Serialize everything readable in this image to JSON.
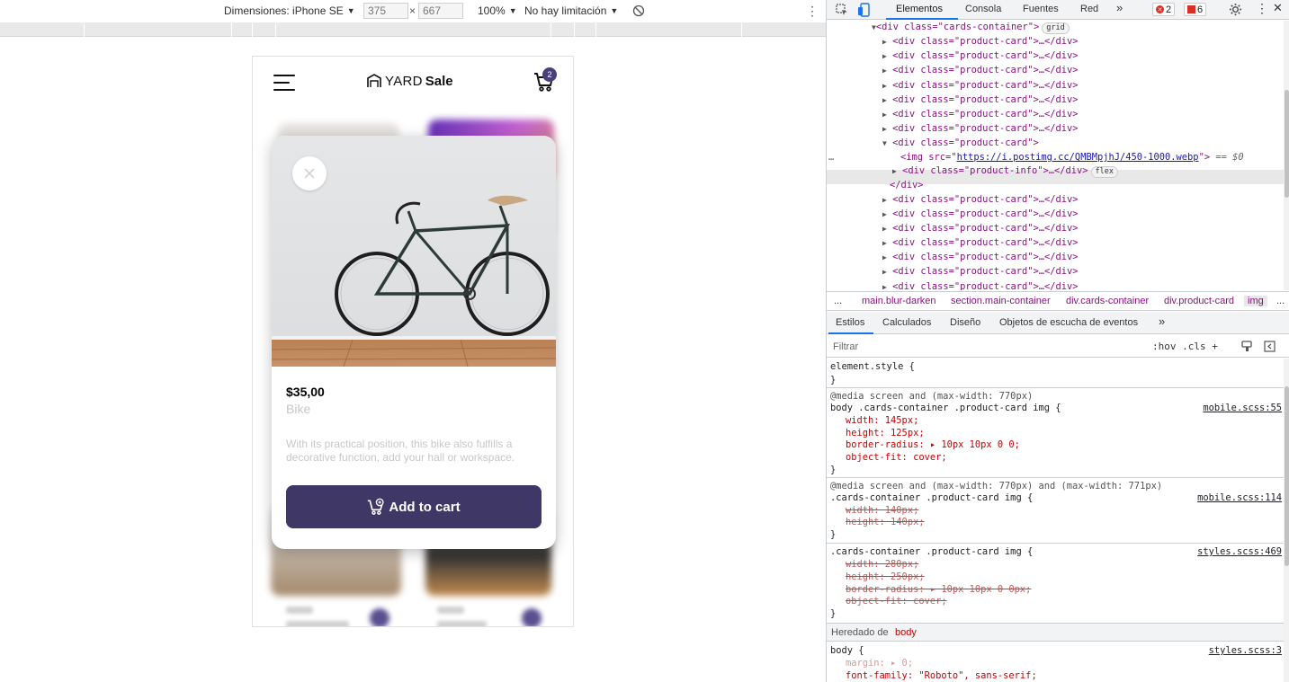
{
  "device_toolbar": {
    "dimensions_label": "Dimensiones: iPhone SE",
    "width": "375",
    "height": "667",
    "times": "×",
    "zoom": "100%",
    "throttle": "No hay limitación"
  },
  "app": {
    "logo_yard": "YARD",
    "logo_sale": "Sale",
    "cart_count": "2"
  },
  "modal": {
    "price": "$35,00",
    "name": "Bike",
    "description": "With its practical position, this bike also fulfills a decorative function, add your hall or workspace.",
    "add_label": "Add to cart"
  },
  "devtools": {
    "tabs": [
      "Elementos",
      "Consola",
      "Fuentes",
      "Red"
    ],
    "errors": "2",
    "warnings": "6",
    "more": "»",
    "dom": {
      "container_open": "<div class=\"cards-container\">",
      "grid": "grid",
      "card_collapsed": "<div class=\"product-card\">…</div>",
      "card_open": "<div class=\"product-card\">",
      "img_tag_prefix": "<img src=\"",
      "img_url": "https://i.postimg.cc/QMBMpjhJ/450-1000.webp",
      "img_tag_suffix": "\">",
      "selected_marker": "== $0",
      "info_line": "<div class=\"product-info\">…</div>",
      "flex": "flex",
      "close_div": "</div>"
    },
    "breadcrumbs": [
      "...",
      "main.blur-darken",
      "section.main-container",
      "div.cards-container",
      "div.product-card",
      "img",
      "..."
    ],
    "style_tabs": [
      "Estilos",
      "Calculados",
      "Diseño",
      "Objetos de escucha de eventos",
      "»"
    ],
    "filter_placeholder": "Filtrar",
    "filter_tools": ":hov  .cls  +",
    "rules": {
      "element_style": "element.style {",
      "close_brace": "}",
      "media1": "@media screen and (max-width: 770px)",
      "selector1": "body .cards-container .product-card img {",
      "source1": "mobile.scss:55",
      "r1_width": "width: 145px;",
      "r1_height": "height: 125px;",
      "r1_radius": "border-radius: ▸ 10px 10px 0 0;",
      "r1_fit": "object-fit: cover;",
      "media2": "@media screen and (max-width: 770px) and (max-width: 771px)",
      "selector2": ".cards-container .product-card img {",
      "source2": "mobile.scss:114",
      "r2_width": "width: 140px;",
      "r2_height": "height: 140px;",
      "selector3": ".cards-container .product-card img {",
      "source3": "styles.scss:469",
      "r3_width": "width: 280px;",
      "r3_height": "height: 250px;",
      "r3_radius": "border-radius: ▸ 10px 10px 0 0px;",
      "r3_fit": "object-fit: cover;",
      "inherited_prefix": "Heredado de",
      "inherited_from": "body",
      "selector4": "body {",
      "source4": "styles.scss:3",
      "r4_margin": "margin: ▸ 0;",
      "r4_font": "font-family: \"Roboto\", sans-serif;"
    }
  }
}
